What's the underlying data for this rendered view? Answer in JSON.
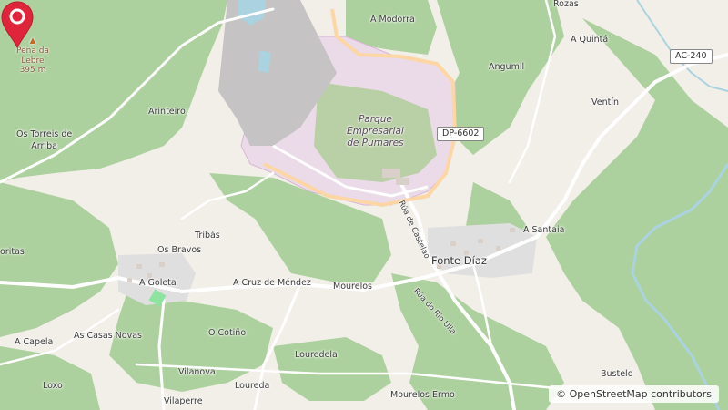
{
  "map": {
    "places": [
      {
        "id": "a-modorra",
        "label": "A Modorra"
      },
      {
        "id": "rozas",
        "label": "Rozas"
      },
      {
        "id": "a-quinta",
        "label": "A Quintá"
      },
      {
        "id": "angumil",
        "label": "Angumil"
      },
      {
        "id": "ventin",
        "label": "Ventín"
      },
      {
        "id": "arinteiro",
        "label": "Arinteiro"
      },
      {
        "id": "os-torreis",
        "label": "Os Torreis de\nArriba"
      },
      {
        "id": "a-santaia",
        "label": "A Santaia"
      },
      {
        "id": "tribas",
        "label": "Tribás"
      },
      {
        "id": "os-bravos",
        "label": "Os Bravos"
      },
      {
        "id": "foritas",
        "label": "oritas"
      },
      {
        "id": "a-goleta",
        "label": "A Goleta"
      },
      {
        "id": "a-cruz",
        "label": "A Cruz de Méndez"
      },
      {
        "id": "mourelos",
        "label": "Mourelos"
      },
      {
        "id": "fonte-diaz",
        "label": "Fonte Díaz"
      },
      {
        "id": "o-cotino",
        "label": "O Cotiño"
      },
      {
        "id": "a-capela",
        "label": "A Capela"
      },
      {
        "id": "as-casas-novas",
        "label": "As Casas Novas"
      },
      {
        "id": "louredela",
        "label": "Louredela"
      },
      {
        "id": "vilanova",
        "label": "Vilanova"
      },
      {
        "id": "loureda",
        "label": "Loureda"
      },
      {
        "id": "loxo",
        "label": "Loxo"
      },
      {
        "id": "vilaperre",
        "label": "Vilaperre"
      },
      {
        "id": "mourelos-ermo",
        "label": "Mourelos Ermo"
      },
      {
        "id": "bustelo",
        "label": "Bustelo"
      }
    ],
    "park_label": "Parque\nEmpresarial\nde Pumares",
    "peak": {
      "name": "Pena da\nLebre",
      "elevation": "395 m"
    },
    "road_shields": [
      {
        "id": "dp-6602",
        "label": "DP-6602"
      },
      {
        "id": "ac-240",
        "label": "AC-240"
      }
    ],
    "street_labels": [
      {
        "id": "rua-de-castelao",
        "label": "Rúa de Castelao"
      },
      {
        "id": "rua-do-rio-ulla",
        "label": "Rúa do Río Ulla"
      }
    ],
    "attribution": "© OpenStreetMap contributors",
    "colors": {
      "forest": "#add19e",
      "land": "#f2efe9",
      "industrial": "#ebdbe8",
      "quarry": "#c5c3c3",
      "residential": "#e0dfdf",
      "water": "#aad3df",
      "road": "#ffffff",
      "primary_road": "#fcd6a4",
      "marker": "#e0243a"
    }
  }
}
